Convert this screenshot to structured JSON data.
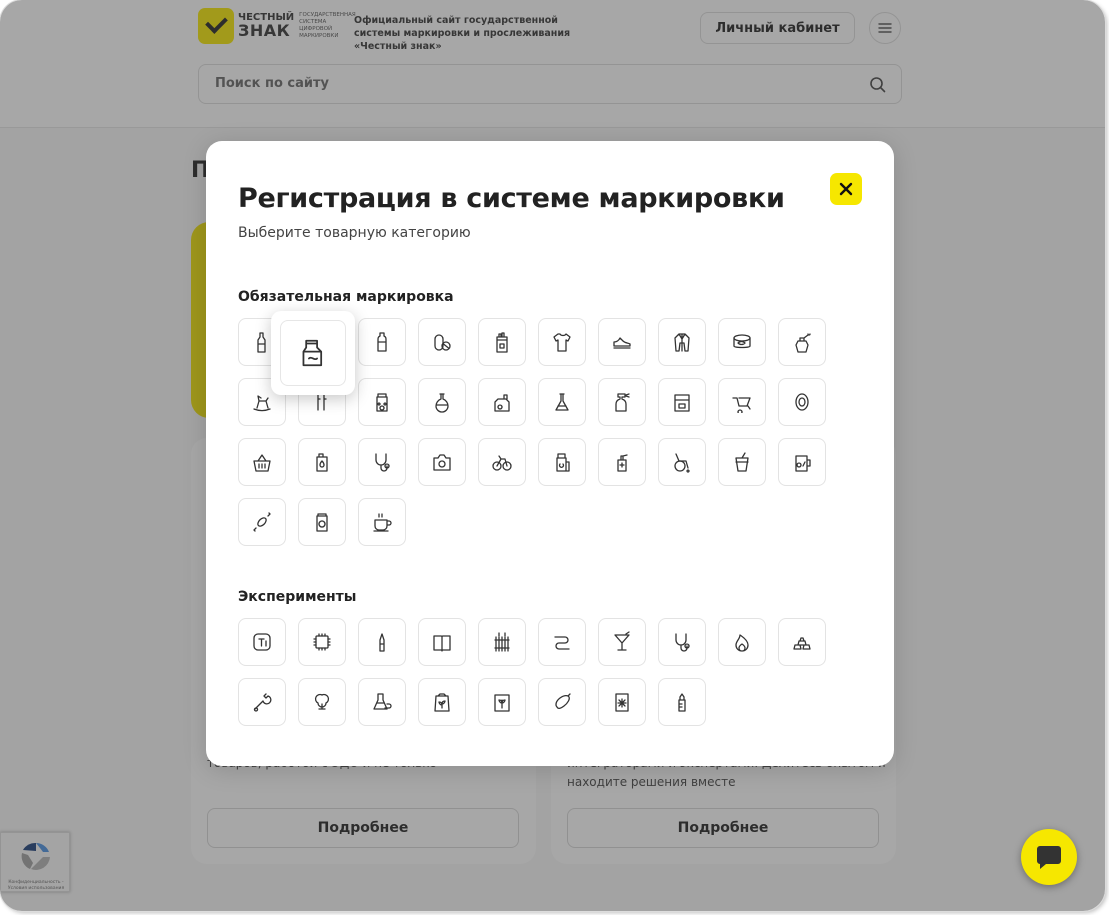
{
  "header": {
    "logo_line1": "ЧЕСТНЫЙ",
    "logo_line2": "ЗНАК",
    "logo_tagline": "государственная система цифровой маркировки",
    "description": "Официальный сайт государственной системы маркировки и прослеживания «Честный знак»",
    "cabinet_label": "Личный кабинет",
    "menu_icon": "hamburger-icon",
    "search_placeholder": "Поиск по сайту"
  },
  "background": {
    "page_title": "П",
    "cards": [
      {
        "text": "товаров, работой с ЭДО и не только",
        "button": "Подробнее"
      },
      {
        "text": "интеграторами и экспертами. Делитесь опытом и находите решения вместе",
        "button": "Подробнее"
      }
    ],
    "recaptcha_text": "Конфиденциальность - Условия использования"
  },
  "modal": {
    "title": "Регистрация в системе маркировки",
    "subtitle": "Выберите товарную категорию",
    "mandatory_title": "Обязательная маркировка",
    "experiments_title": "Эксперименты",
    "mandatory_icons": [
      "alcohol-bottle-icon",
      "dairy-carton-icon",
      "water-bottle-icon",
      "medicine-pills-icon",
      "tobacco-pack-icon",
      "tshirt-icon",
      "shoe-icon",
      "fur-coat-icon",
      "canned-fish-icon",
      "perfume-icon",
      "rocking-horse-icon",
      "nicotine-icon",
      "pet-food-jar-icon",
      "chemistry-flask-icon",
      "cosmetics-icon",
      "lab-flask-icon",
      "spray-bottle-icon",
      "construction-materials-icon",
      "wheelbarrow-icon",
      "tire-icon",
      "grocery-basket-icon",
      "oil-canister-icon",
      "stethoscope-icon",
      "camera-icon",
      "bicycle-icon",
      "supplements-icon",
      "antiseptic-icon",
      "wheelchair-icon",
      "soft-drink-icon",
      "beer-zero-icon",
      "candy-icon",
      "canned-food-icon",
      "coffee-cup-icon"
    ],
    "experiment_icons": [
      "titanium-icon",
      "microchip-icon",
      "vape-icon",
      "book-icon",
      "radiator-icon",
      "cable-icon",
      "cocktail-glass-icon",
      "stethoscope-icon",
      "fire-icon",
      "gold-bars-icon",
      "tools-icon",
      "cotton-icon",
      "tea-icon",
      "seed-bag-icon",
      "pet-supplies-icon",
      "sausage-icon",
      "frozen-bag-icon",
      "baby-bottle-icon"
    ],
    "hovered_icon": "dairy-carton-icon"
  }
}
